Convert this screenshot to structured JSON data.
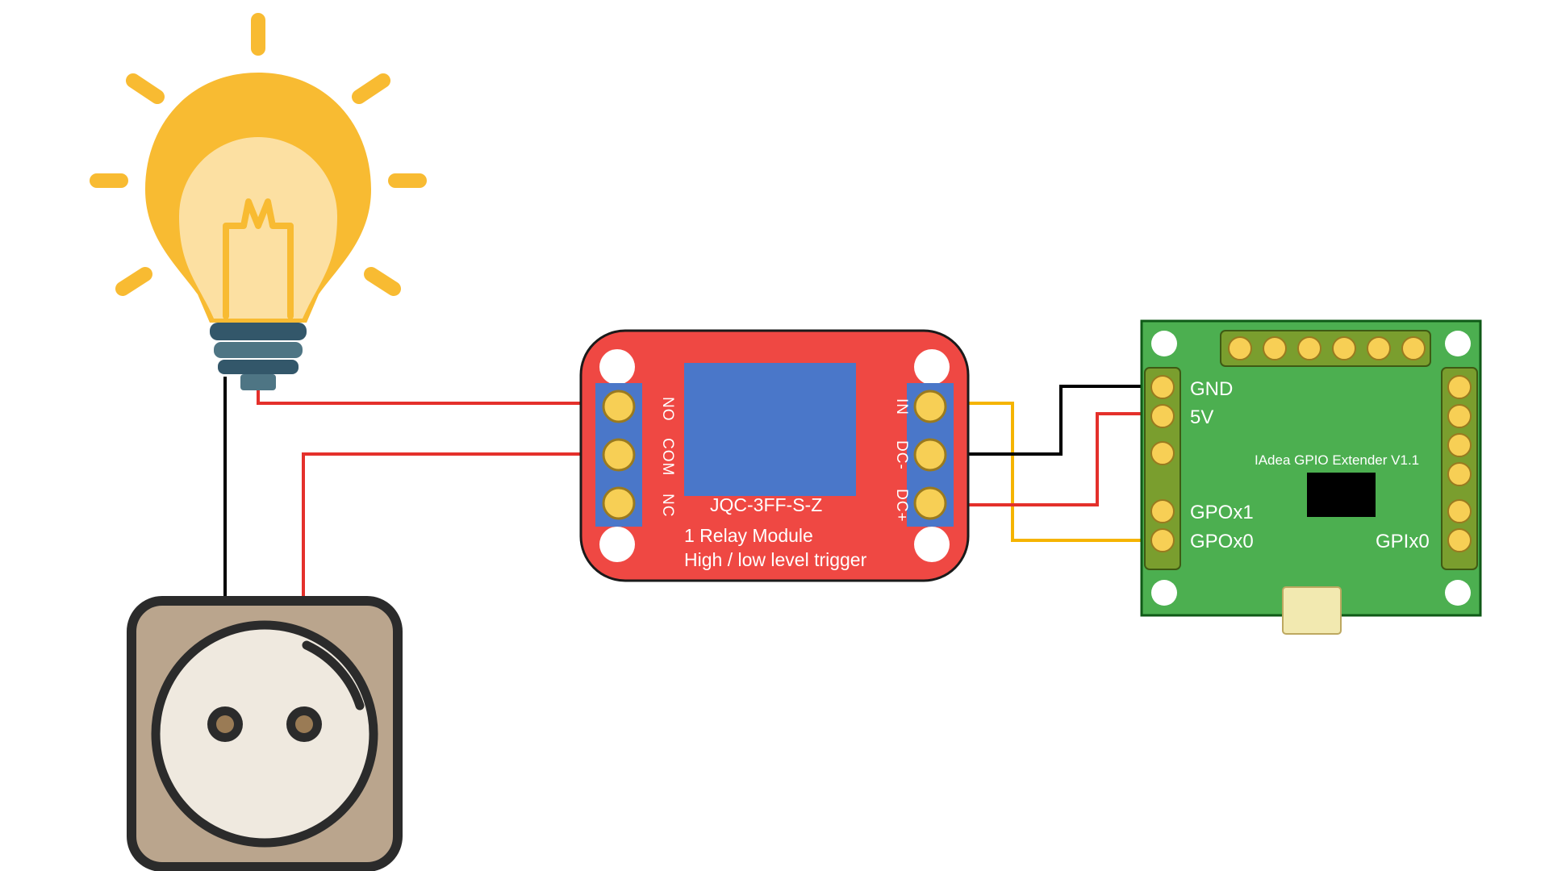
{
  "relay": {
    "chip": "JQC-3FF-S-Z",
    "title1": "1 Relay Module",
    "title2": "High / low level trigger",
    "left_pins": [
      "NO",
      "COM",
      "NC"
    ],
    "right_pins": [
      "IN",
      "DC-",
      "DC+"
    ]
  },
  "gpio": {
    "title": "IAdea GPIO Extender V1.1",
    "gnd": "GND",
    "v5": "5V",
    "gpox1": "GPOx1",
    "gpox0": "GPOx0",
    "gpix0": "GPIx0"
  },
  "wires": {
    "black_bulb_socket": "bulb to socket (black)",
    "red_bulb_relayNO": "bulb to relay NO (red)",
    "red_socket_relayCOM": "socket to relay COM (red)",
    "yellow_relayIN_gpox0": "relay IN to GPOx0 (yellow)",
    "black_relayDCm_gnd": "relay DC- to GND (black)",
    "red_relayDCp_5v": "relay DC+ to 5V (red)"
  }
}
